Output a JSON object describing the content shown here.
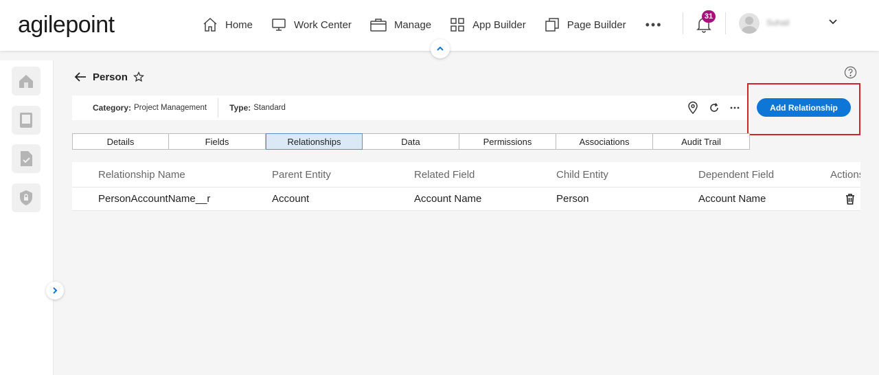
{
  "app": {
    "logo_text": "agilepoint",
    "user_name": "Suhail",
    "notification_count": "31"
  },
  "nav": {
    "items": [
      {
        "label": "Home",
        "icon": "home-icon"
      },
      {
        "label": "Work Center",
        "icon": "monitor-icon"
      },
      {
        "label": "Manage",
        "icon": "briefcase-icon"
      },
      {
        "label": "App Builder",
        "icon": "grid-icon"
      },
      {
        "label": "Page Builder",
        "icon": "pages-icon"
      }
    ],
    "more_label": "•••"
  },
  "page": {
    "title": "Person",
    "category_label": "Category:",
    "category_value": "Project Management",
    "type_label": "Type:",
    "type_value": "Standard",
    "add_button": "Add Relationship"
  },
  "tabs": [
    "Details",
    "Fields",
    "Relationships",
    "Data",
    "Permissions",
    "Associations",
    "Audit Trail"
  ],
  "active_tab": "Relationships",
  "table": {
    "columns": [
      "Relationship Name",
      "Parent Entity",
      "Related Field",
      "Child Entity",
      "Dependent Field",
      "Actions"
    ],
    "rows": [
      {
        "relationship_name": "PersonAccountName__r",
        "parent_entity": "Account",
        "related_field": "Account Name",
        "child_entity": "Person",
        "dependent_field": "Account Name"
      }
    ]
  },
  "colors": {
    "primary": "#0d76d6",
    "badge": "#a8117b",
    "highlight": "#d2232a",
    "link": "#1a73c8"
  }
}
